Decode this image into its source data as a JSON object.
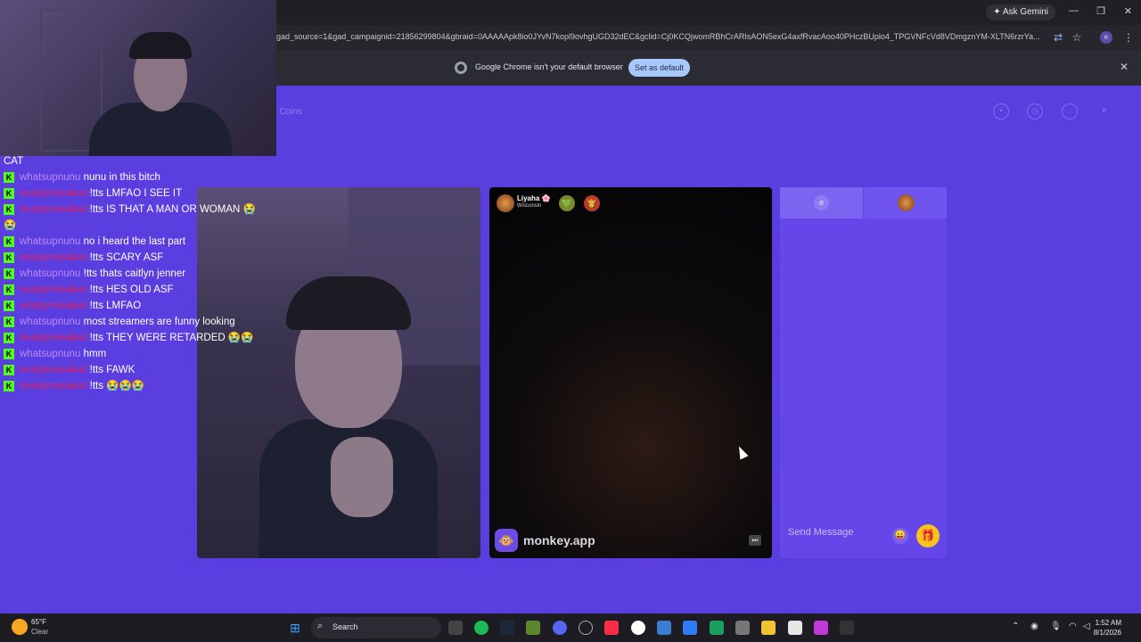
{
  "browser": {
    "ask_gemini": "Ask Gemini",
    "url": "gad_source=1&gad_campaignid=21856299804&gbraid=0AAAAApk8io0JYvN7kopl9ovhgUGD32dEC&gclid=Cj0KCQjwomRBhCrARIsAON5exG4axfRvacAoo40PHczBUplo4_TPGVNFcVd8VDmgznYM-XLTN6rzrYa...",
    "infobar_message": "Google Chrome isn't your default browser",
    "set_default_label": "Set as default",
    "close_glyph": "✕",
    "minimize_glyph": "—",
    "restore_glyph": "❐",
    "win_close_glyph": "✕"
  },
  "page": {
    "coins_label": "e Coins",
    "profile_initial": "e"
  },
  "video_peer": {
    "name": "Liyaha 🌸",
    "location": "Wisconsin",
    "brand": "monkey.app",
    "badge1": "💚",
    "badge2": "👸"
  },
  "chat_panel": {
    "tab_initial": "e",
    "send_placeholder": "Send Message",
    "emoji": "😛",
    "gift": "🎁"
  },
  "stream_chat": {
    "top_fragment": "CAT",
    "lines": [
      {
        "user": "whatsupnunu",
        "text": "nunu in this bitch",
        "color": "u1"
      },
      {
        "user": "mostyrnrealest",
        "text": "!tts LMFAO I SEE IT",
        "color": "u2"
      },
      {
        "user": "mostyrnrealest",
        "text": "!tts IS THAT A MAN OR WOMAN 😭😭",
        "color": "u2"
      },
      {
        "user": "whatsupnunu",
        "text": "no i heard the last part",
        "color": "u1"
      },
      {
        "user": "mostyrnrealest",
        "text": "!tts SCARY ASF",
        "color": "u2"
      },
      {
        "user": "whatsupnunu",
        "text": "!tts thats caitlyn jenner",
        "color": "u1"
      },
      {
        "user": "mostyrnrealest",
        "text": "!tts HES OLD ASF",
        "color": "u2"
      },
      {
        "user": "mostyrnrealest",
        "text": "!tts LMFAO",
        "color": "u2"
      },
      {
        "user": "whatsupnunu",
        "text": "most streamers are funny looking",
        "color": "u1"
      },
      {
        "user": "mostyrnrealest",
        "text": "!tts THEY WERE RETARDED 😭😭",
        "color": "u2"
      },
      {
        "user": "whatsupnunu",
        "text": "hmm",
        "color": "u1"
      },
      {
        "user": "mostyrnrealest",
        "text": "!tts FAWK",
        "color": "u2"
      },
      {
        "user": "mostyrnrealest",
        "text": "!tts 😭😭😭",
        "color": "u2"
      }
    ]
  },
  "taskbar": {
    "temp": "65°F",
    "weather": "Clear",
    "search_label": "Search",
    "time": "1:52 AM",
    "date": "8/1/2026"
  }
}
